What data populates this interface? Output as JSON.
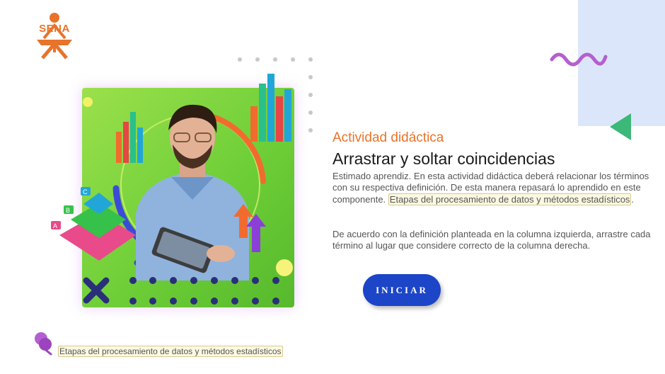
{
  "brand": {
    "logo_text": "SENA",
    "color": "#e8732a"
  },
  "activity": {
    "kicker": "Actividad didáctica",
    "title": "Arrastrar y soltar coincidencias",
    "paragraph1_text": "Estimado aprendiz. En esta actividad didáctica deberá relacionar los términos  con su respectiva definición. De esta manera repasará lo aprendido en este componente.",
    "paragraph1_highlight": "Etapas del procesamiento de datos y métodos estadísticos",
    "paragraph2": "De acuerdo con la definición planteada en la columna izquierda, arrastre cada término al lugar que considere correcto de la columna derecha."
  },
  "buttons": {
    "start_label": "INICIAR"
  },
  "footer": {
    "component_label": "Etapas del procesamiento de datos y métodos estadísticos"
  },
  "illustration": {
    "pyramid_labels": [
      "A",
      "B",
      "C"
    ]
  },
  "colors": {
    "accent_orange": "#e8732a",
    "button_blue": "#1c45c7",
    "panel_lavender": "#dce6fb",
    "wave_purple": "#b45fcf",
    "triangle_green": "#3cb878",
    "hero_green": "#6fcf38"
  }
}
